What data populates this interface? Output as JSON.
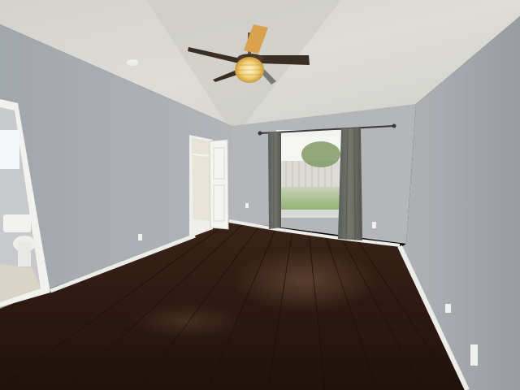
{
  "scene": {
    "kind": "photo",
    "subject": "empty-bedroom-interior"
  },
  "colors": {
    "ceiling": "#d9d8d3",
    "wall_left": "#a9acb2",
    "wall_back": "#b3b5b8",
    "wall_right": "#9fa3a8",
    "floor": "#2a1812",
    "baseboard": "#eeeeea",
    "curtain": "#6a6c6a",
    "window_light": "#eef1ea",
    "lawn": "#9fb880",
    "fan_blade": "#3a2d24",
    "fan_light": "#f2d27a"
  }
}
